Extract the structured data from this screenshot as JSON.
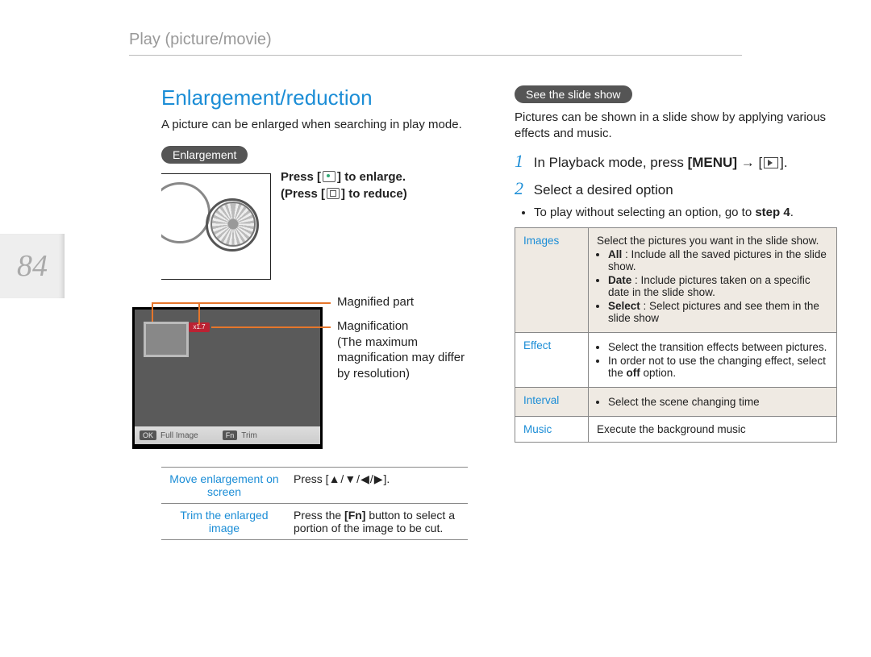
{
  "page_number": "84",
  "header": "Play (picture/movie)",
  "left": {
    "section_title": "Enlargement/reduction",
    "intro": "A picture can be enlarged when searching in play mode.",
    "enlargement_pill": "Enlargement",
    "press_enlarge_prefix": "Press [",
    "press_enlarge_suffix": "] to enlarge.",
    "press_reduce_prefix": "(Press [",
    "press_reduce_suffix": "] to reduce)",
    "magni_badge": "x1.7",
    "callout_magnified_part": "Magnified part",
    "callout_magnification": "Magnification\n(The maximum magnification may differ by resolution)",
    "lcd_ok": "OK",
    "lcd_full_image": "Full Image",
    "lcd_fn": "Fn",
    "lcd_trim": "Trim",
    "mini_table": {
      "row1_label": "Move enlargement on screen",
      "row1_text_prefix": "Press [",
      "row1_text_arrows": "▲/▼/◀/▶",
      "row1_text_suffix": "].",
      "row2_label": "Trim the enlarged image",
      "row2_text_prefix": "Press the ",
      "row2_text_bold": "[Fn]",
      "row2_text_suffix": " button to select a portion of the image to be cut."
    }
  },
  "right": {
    "slideshow_pill": "See the slide show",
    "slideshow_intro": "Pictures can be shown in a slide show by applying various effects and music.",
    "step1_prefix": "In Playback mode, press ",
    "step1_menu": "[MENU]",
    "step1_arrow": " → [",
    "step1_suffix": "].",
    "step2": "Select a desired option",
    "step2_bullet_prefix": "To play without selecting an option, go to ",
    "step2_bullet_bold": "step 4",
    "step2_bullet_suffix": ".",
    "opts": {
      "images_label": "Images",
      "images_intro": "Select the pictures you want in the slide show.",
      "images_all_b": "All",
      "images_all": " : Include all the saved pictures in the slide show.",
      "images_date_b": "Date",
      "images_date": " : Include pictures taken on a specific date in the slide show.",
      "images_select_b": "Select",
      "images_select": " : Select pictures and see them in the slide show",
      "effect_label": "Effect",
      "effect_1": "Select the transition effects between pictures.",
      "effect_2_prefix": "In order not to use the changing effect, select the ",
      "effect_2_bold": "off",
      "effect_2_suffix": " option.",
      "interval_label": "Interval",
      "interval_text": "Select the scene changing time",
      "music_label": "Music",
      "music_text": "Execute the background music"
    }
  }
}
